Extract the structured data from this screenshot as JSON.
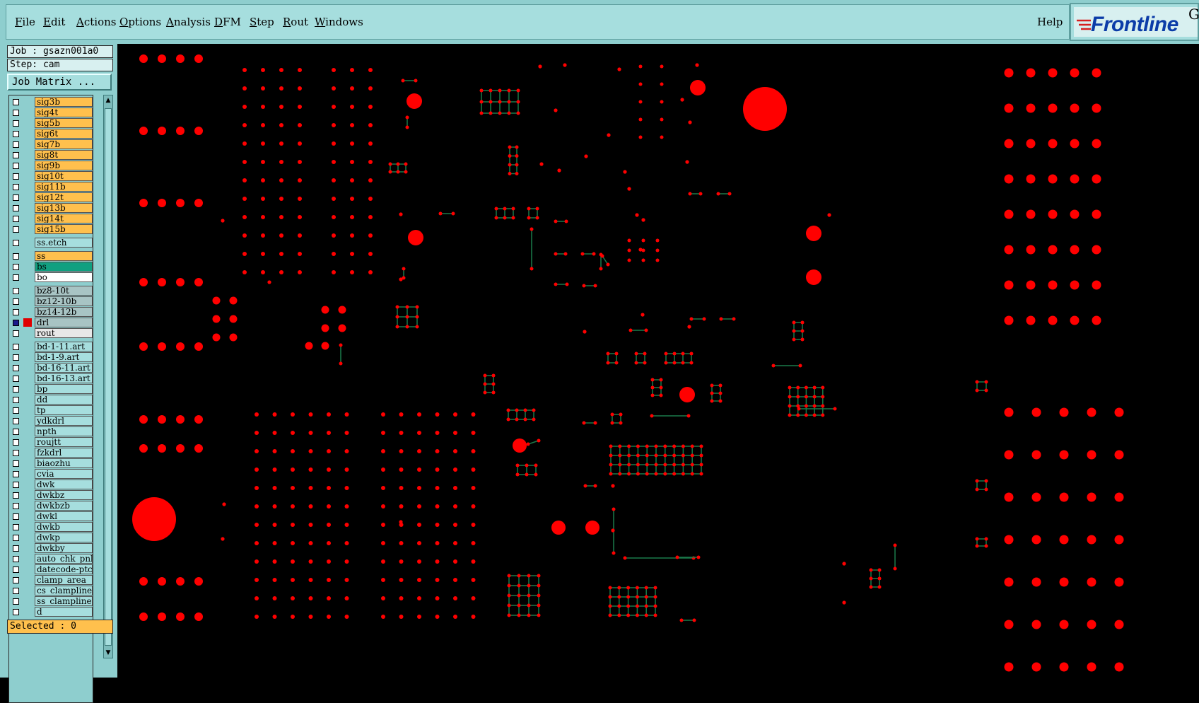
{
  "menu": {
    "items": [
      {
        "ul": "F",
        "rest": "ile"
      },
      {
        "ul": "E",
        "rest": "dit"
      },
      {
        "ul": "A",
        "rest": "ctions"
      },
      {
        "ul": "O",
        "rest": "ptions"
      },
      {
        "ul": "A",
        "rest": "nalysis"
      },
      {
        "ul": "D",
        "rest": "FM"
      },
      {
        "ul": "S",
        "rest": "tep"
      },
      {
        "ul": "R",
        "rest": "out"
      },
      {
        "ul": "W",
        "rest": "indows"
      }
    ],
    "help": "Help"
  },
  "logo": {
    "text": "Frontline",
    "edge_char": "G",
    "color": "#0b3ca8"
  },
  "job": {
    "job_label": "Job : gsazn001a0",
    "step_label": "Step: cam",
    "matrix_button": "Job Matrix ..."
  },
  "layers": [
    {
      "name": "sig3b",
      "color": "#ffc04d"
    },
    {
      "name": "sig4t",
      "color": "#ffc04d"
    },
    {
      "name": "sig5b",
      "color": "#ffc04d"
    },
    {
      "name": "sig6t",
      "color": "#ffc04d"
    },
    {
      "name": "sig7b",
      "color": "#ffc04d"
    },
    {
      "name": "sig8t",
      "color": "#ffc04d"
    },
    {
      "name": "sig9b",
      "color": "#ffc04d"
    },
    {
      "name": "sig10t",
      "color": "#ffc04d"
    },
    {
      "name": "sig11b",
      "color": "#ffc04d"
    },
    {
      "name": "sig12t",
      "color": "#ffc04d"
    },
    {
      "name": "sig13b",
      "color": "#ffc04d"
    },
    {
      "name": "sig14t",
      "color": "#ffc04d"
    },
    {
      "name": "sig15b",
      "color": "#ffc04d"
    },
    {
      "name": "ss.etch",
      "color": "#a6dede"
    },
    {
      "name": "ss",
      "color": "#ffc04d"
    },
    {
      "name": "bs",
      "color": "#10a080"
    },
    {
      "name": "bo",
      "color": "#ffffff"
    },
    {
      "name": "bz8-10t",
      "color": "#a8c4c4"
    },
    {
      "name": "bz12-10b",
      "color": "#a8c4c4"
    },
    {
      "name": "bz14-12b",
      "color": "#a8c4c4"
    },
    {
      "name": "drl",
      "color": "#a8c4c4",
      "active": true
    },
    {
      "name": "rout",
      "color": "#e8e8e8"
    },
    {
      "name": "bd-1-11.art",
      "color": "#a6dede"
    },
    {
      "name": "bd-1-9.art",
      "color": "#a6dede"
    },
    {
      "name": "bd-16-11.art",
      "color": "#a6dede"
    },
    {
      "name": "bd-16-13.art",
      "color": "#a6dede"
    },
    {
      "name": "bp",
      "color": "#a6dede"
    },
    {
      "name": "dd",
      "color": "#a6dede"
    },
    {
      "name": "tp",
      "color": "#a6dede"
    },
    {
      "name": "ydkdrl",
      "color": "#a6dede"
    },
    {
      "name": "npth",
      "color": "#a6dede"
    },
    {
      "name": "roujtt",
      "color": "#a6dede"
    },
    {
      "name": "fzkdrl",
      "color": "#a6dede"
    },
    {
      "name": "biaozhu",
      "color": "#a6dede"
    },
    {
      "name": "cvia",
      "color": "#a6dede"
    },
    {
      "name": "dwk",
      "color": "#a6dede"
    },
    {
      "name": "dwkbz",
      "color": "#a6dede"
    },
    {
      "name": "dwkbzb",
      "color": "#a6dede"
    },
    {
      "name": "dwkl",
      "color": "#a6dede"
    },
    {
      "name": "dwkb",
      "color": "#a6dede"
    },
    {
      "name": "dwkp",
      "color": "#a6dede"
    },
    {
      "name": "dwkby",
      "color": "#a6dede"
    },
    {
      "name": "auto_chk_pnl",
      "color": "#a6dede"
    },
    {
      "name": "datecode-ptc",
      "color": "#a6dede"
    },
    {
      "name": "clamp_area",
      "color": "#a6dede"
    },
    {
      "name": "cs_clampline",
      "color": "#a6dede"
    },
    {
      "name": "ss_clampline",
      "color": "#a6dede"
    },
    {
      "name": "d",
      "color": "#a6dede"
    }
  ],
  "status": {
    "selected_label": "Selected : 0"
  },
  "colors": {
    "feature": "#ff0000",
    "trace": "#1a7a4a",
    "canvas_bg": "#000000"
  }
}
